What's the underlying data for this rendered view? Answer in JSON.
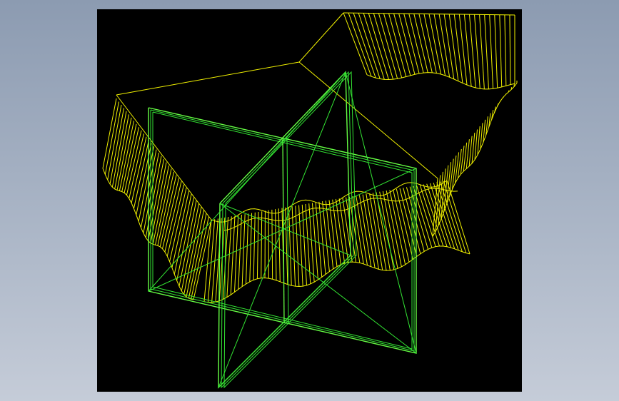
{
  "viewport": {
    "background": "#000000",
    "model": "wireframe",
    "colors": {
      "cloth": "#f2f200",
      "glass_frame": "#33e533",
      "glass_frame_bright": "#66ff44"
    },
    "objects": [
      {
        "name": "tablecloth",
        "color_key": "cloth",
        "style": "draped-wireframe"
      },
      {
        "name": "glass-panel-front",
        "color_key": "glass_frame",
        "style": "thin-frame"
      },
      {
        "name": "glass-panel-cross",
        "color_key": "glass_frame",
        "style": "thin-frame"
      }
    ]
  }
}
